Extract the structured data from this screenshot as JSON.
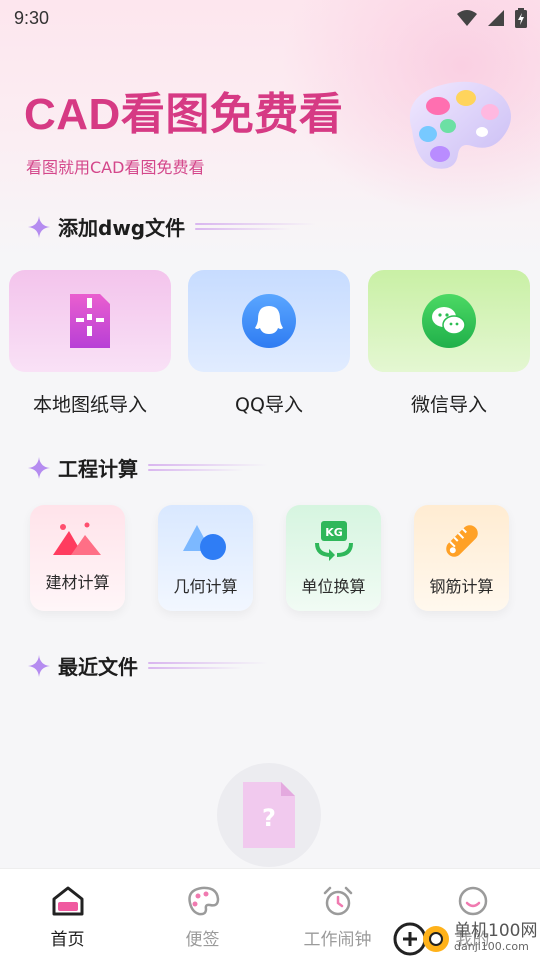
{
  "status_bar": {
    "time": "9:30"
  },
  "hero": {
    "title": "CAD看图免费看",
    "subtitle": "看图就用CAD看图免费看"
  },
  "sections": {
    "add_files": "添加dwg文件",
    "engineering": "工程计算",
    "recent": "最近文件"
  },
  "import_options": [
    {
      "label": "本地图纸导入",
      "icon": "local-file-icon"
    },
    {
      "label": "QQ导入",
      "icon": "qq-icon"
    },
    {
      "label": "微信导入",
      "icon": "wechat-icon"
    }
  ],
  "calculators": [
    {
      "label": "建材计算",
      "icon": "mountain-icon"
    },
    {
      "label": "几何计算",
      "icon": "geometry-icon"
    },
    {
      "label": "单位换算",
      "icon": "kg-convert-icon"
    },
    {
      "label": "钢筋计算",
      "icon": "ruler-icon"
    }
  ],
  "empty_state": {
    "icon": "unknown-file-icon",
    "glyph": "?"
  },
  "bottom_nav": [
    {
      "label": "首页",
      "icon": "home-icon",
      "active": true
    },
    {
      "label": "便签",
      "icon": "palette-icon",
      "active": false
    },
    {
      "label": "工作闹钟",
      "icon": "alarm-clock-icon",
      "active": false
    },
    {
      "label": "我的",
      "icon": "smiley-icon",
      "active": false
    }
  ],
  "watermark": {
    "text": "单机100网",
    "url": "danji100.com"
  },
  "colors": {
    "accent": "#d63a84",
    "spark": "#b58cf0",
    "nav_active": "#1c1c1c",
    "nav_inactive": "#9b9b9b"
  }
}
